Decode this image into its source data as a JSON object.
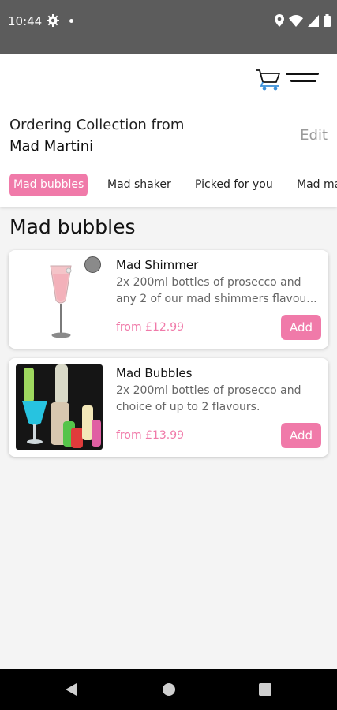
{
  "status_bar": {
    "time": "10:44"
  },
  "header": {
    "ordering_label": "Ordering Collection from",
    "store_name": "Mad Martini",
    "edit_label": "Edit"
  },
  "tabs": [
    {
      "label": "Mad bubbles",
      "active": true
    },
    {
      "label": "Mad shaker",
      "active": false
    },
    {
      "label": "Picked for you",
      "active": false
    },
    {
      "label": "Mad ma",
      "active": false
    }
  ],
  "section": {
    "title": "Mad bubbles"
  },
  "products": [
    {
      "name": "Mad Shimmer",
      "description": "2x 200ml bottles of prosecco and any 2 of our mad shimmers flavou...",
      "price": "from £12.99",
      "add_label": "Add"
    },
    {
      "name": "Mad Bubbles",
      "description": "2x 200ml bottles of prosecco and choice of up to 2 flavours.",
      "price": "from £13.99",
      "add_label": "Add"
    }
  ],
  "colors": {
    "accent": "#f07aa9",
    "status_bar": "#5c5c5c",
    "nav_bar": "#000000"
  },
  "icons": [
    "gear-icon",
    "location-icon",
    "wifi-icon",
    "signal-icon",
    "battery-icon",
    "cart-icon",
    "menu-icon",
    "back-icon",
    "home-icon",
    "recents-icon"
  ]
}
